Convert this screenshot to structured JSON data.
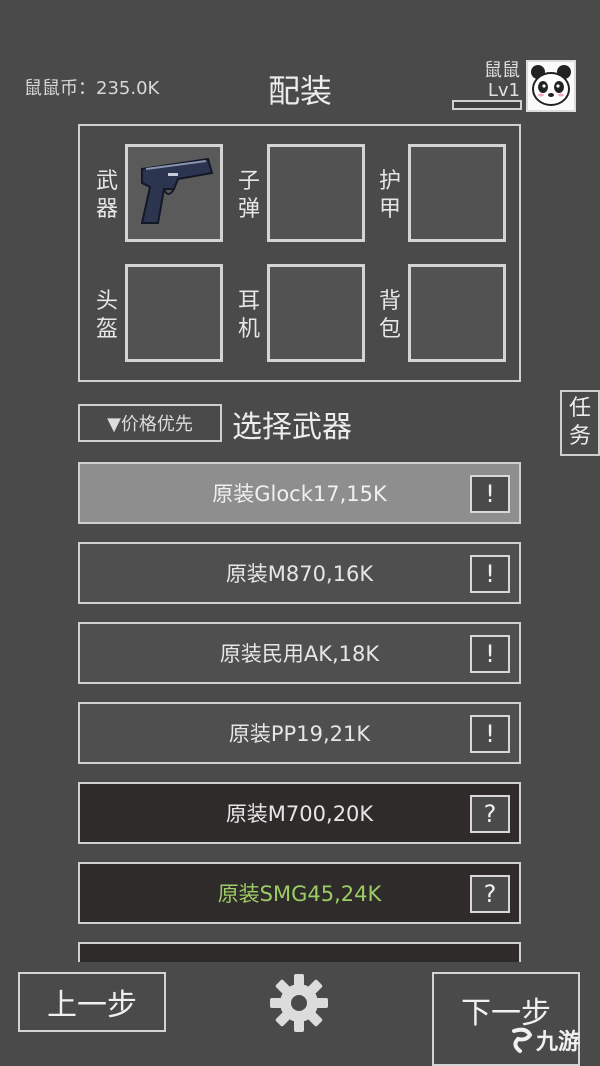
{
  "header": {
    "coins_label": "鼠鼠币：235.0K",
    "title": "配装",
    "player_name": "鼠鼠",
    "player_level": "Lv1",
    "xp_progress": 0.0
  },
  "equipment": {
    "slots": [
      {
        "label_top": "武",
        "label_bottom": "器",
        "filled": true,
        "icon": "pistol-icon"
      },
      {
        "label_top": "子",
        "label_bottom": "弹",
        "filled": false
      },
      {
        "label_top": "护",
        "label_bottom": "甲",
        "filled": false
      },
      {
        "label_top": "头",
        "label_bottom": "盔",
        "filled": false
      },
      {
        "label_top": "耳",
        "label_bottom": "机",
        "filled": false
      },
      {
        "label_top": "背",
        "label_bottom": "包",
        "filled": false
      }
    ]
  },
  "controls": {
    "sort_label": "▼价格优先",
    "section_title": "选择武器",
    "task_tab_top": "任",
    "task_tab_bottom": "务"
  },
  "weapons": [
    {
      "label": "原装Glock17,15K",
      "state": "selected",
      "badge": "!",
      "color": "#f0f0f0"
    },
    {
      "label": "原装M870,16K",
      "state": "owned",
      "badge": "!",
      "color": "#e6e6e6"
    },
    {
      "label": "原装民用AK,18K",
      "state": "owned",
      "badge": "!",
      "color": "#e6e6e6"
    },
    {
      "label": "原装PP19,21K",
      "state": "owned",
      "badge": "!",
      "color": "#e6e6e6"
    },
    {
      "label": "原装M700,20K",
      "state": "locked",
      "badge": "?",
      "color": "#e6e6e6"
    },
    {
      "label": "原装SMG45,24K",
      "state": "locked",
      "badge": "?",
      "color": "#9ccc65"
    }
  ],
  "footer": {
    "prev_label": "上一步",
    "next_label": "下一步",
    "watermark": "九游"
  }
}
